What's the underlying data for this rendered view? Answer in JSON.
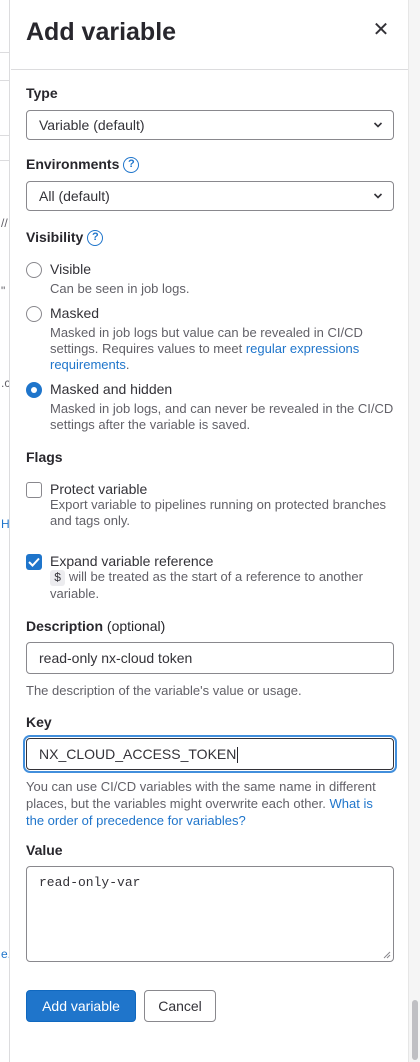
{
  "drawer": {
    "title": "Add variable"
  },
  "type": {
    "label": "Type",
    "selected": "Variable (default)"
  },
  "environments": {
    "label": "Environments",
    "selected": "All (default)"
  },
  "visibility": {
    "label": "Visibility",
    "options": [
      {
        "title": "Visible",
        "help": "Can be seen in job logs.",
        "checked": false
      },
      {
        "title": "Masked",
        "help": "Masked in job logs but value can be revealed in CI/CD settings. Requires values to meet ",
        "help_link": "regular expressions requirements",
        "help_end": ".",
        "checked": false
      },
      {
        "title": "Masked and hidden",
        "help": "Masked in job logs, and can never be revealed in the CI/CD settings after the variable is saved.",
        "checked": true
      }
    ]
  },
  "flags": {
    "label": "Flags",
    "protect": {
      "title": "Protect variable",
      "help": "Export variable to pipelines running on protected branches and tags only.",
      "checked": false
    },
    "expand": {
      "title": "Expand variable reference",
      "code": "$",
      "help": " will be treated as the start of a reference to another variable.",
      "checked": true
    }
  },
  "description": {
    "label": "Description",
    "optional": "(optional)",
    "value": "read-only nx-cloud token",
    "help": "The description of the variable's value or usage."
  },
  "key": {
    "label": "Key",
    "value": "NX_CLOUD_ACCESS_TOKEN",
    "help": "You can use CI/CD variables with the same name in different places, but the variables might overwrite each other. ",
    "help_link": "What is the order of precedence for variables?"
  },
  "value": {
    "label": "Value",
    "value": "read-only-var"
  },
  "actions": {
    "submit": "Add variable",
    "cancel": "Cancel"
  },
  "background": {
    "fragments": [
      "//",
      "\"",
      ".c",
      "H",
      "e."
    ]
  },
  "colors": {
    "primary": "#1f75cb",
    "focus_ring": "#428fdc",
    "text": "#333238",
    "muted": "#626168"
  }
}
